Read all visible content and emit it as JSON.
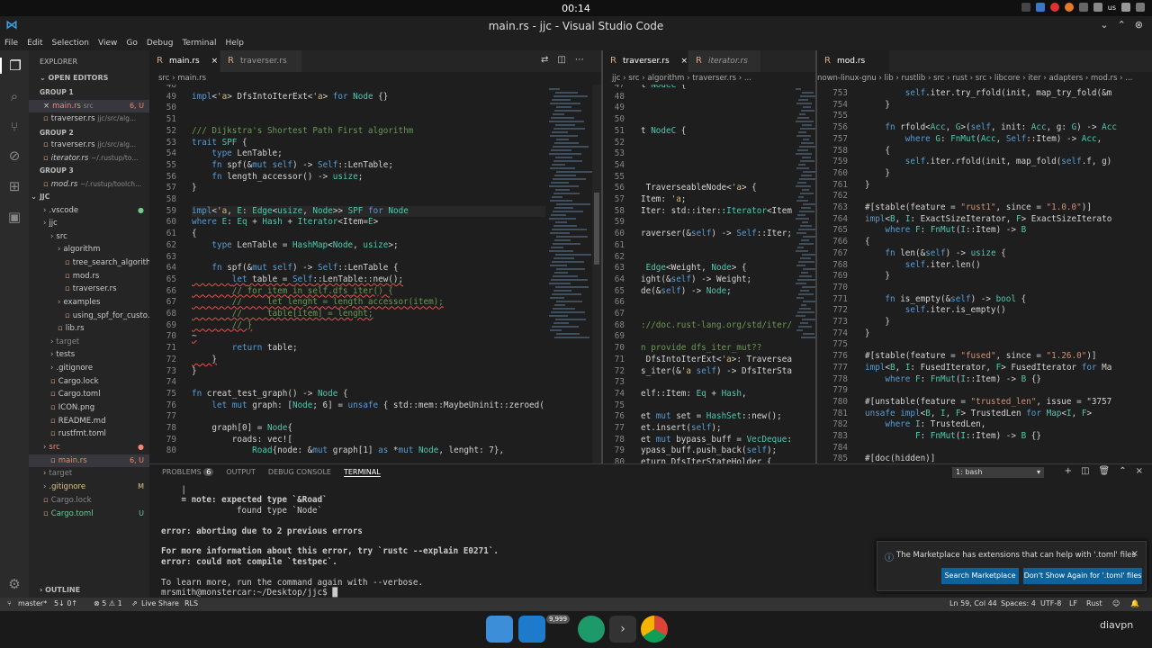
{
  "system": {
    "clock": "00:14",
    "locale": "us"
  },
  "window": {
    "title": "main.rs - jjc - Visual Studio Code"
  },
  "menu": [
    "File",
    "Edit",
    "Selection",
    "View",
    "Go",
    "Debug",
    "Terminal",
    "Help"
  ],
  "sidebar": {
    "title": "EXPLORER",
    "open_editors": "OPEN EDITORS",
    "items": [
      {
        "label": "GROUP 1",
        "cls": "hdr",
        "lvl": 0
      },
      {
        "label": "main.rs",
        "hint": "src",
        "badge": "6, U",
        "cls": "err",
        "lvl": 1,
        "x": true,
        "sel": true
      },
      {
        "label": "traverser.rs",
        "hint": "jjc/src/alg...",
        "cls": "",
        "lvl": 1
      },
      {
        "label": "GROUP 2",
        "cls": "hdr",
        "lvl": 0
      },
      {
        "label": "traverser.rs",
        "hint": "jjc/src/alg...",
        "cls": "",
        "lvl": 1
      },
      {
        "label": "iterator.rs",
        "hint": "~/.rustup/to...",
        "cls": "ital",
        "lvl": 1
      },
      {
        "label": "GROUP 3",
        "cls": "hdr",
        "lvl": 0
      },
      {
        "label": "mod.rs",
        "hint": "~/.rustup/toolch...",
        "cls": "ital",
        "lvl": 1
      },
      {
        "label": "JJC",
        "cls": "hdr",
        "lvl": -1
      },
      {
        "label": ".vscode",
        "cls": "",
        "lvl": 1,
        "dot": "untr"
      },
      {
        "label": "jjc",
        "cls": "",
        "lvl": 1
      },
      {
        "label": "src",
        "cls": "",
        "lvl": 2
      },
      {
        "label": "algorithm",
        "cls": "",
        "lvl": 3
      },
      {
        "label": "tree_search_algorith...",
        "cls": "",
        "lvl": 4
      },
      {
        "label": "mod.rs",
        "cls": "",
        "lvl": 4
      },
      {
        "label": "traverser.rs",
        "cls": "",
        "lvl": 4
      },
      {
        "label": "examples",
        "cls": "",
        "lvl": 3
      },
      {
        "label": "using_spf_for_custo...",
        "cls": "",
        "lvl": 4
      },
      {
        "label": "lib.rs",
        "cls": "",
        "lvl": 3
      },
      {
        "label": "target",
        "cls": "dim",
        "lvl": 2
      },
      {
        "label": "tests",
        "cls": "",
        "lvl": 2
      },
      {
        "label": ".gitignore",
        "cls": "",
        "lvl": 2
      },
      {
        "label": "Cargo.lock",
        "cls": "",
        "lvl": 2
      },
      {
        "label": "Cargo.toml",
        "cls": "",
        "lvl": 2
      },
      {
        "label": "ICON.png",
        "cls": "",
        "lvl": 2
      },
      {
        "label": "README.md",
        "cls": "",
        "lvl": 2
      },
      {
        "label": "rustfmt.toml",
        "cls": "",
        "lvl": 2
      },
      {
        "label": "src",
        "cls": "err",
        "lvl": 1,
        "dot": "err"
      },
      {
        "label": "main.rs",
        "badge": "6, U",
        "cls": "err",
        "lvl": 2,
        "sel": true
      },
      {
        "label": "target",
        "cls": "dim",
        "lvl": 1
      },
      {
        "label": ".gitignore",
        "badge": "M",
        "cls": "mod",
        "lvl": 1
      },
      {
        "label": "Cargo.lock",
        "cls": "dim",
        "lvl": 1
      },
      {
        "label": "Cargo.toml",
        "badge": "U",
        "cls": "untr",
        "lvl": 1
      }
    ],
    "outline": "OUTLINE"
  },
  "groups": [
    {
      "tabs": [
        {
          "label": "main.rs",
          "active": true,
          "close": "×"
        },
        {
          "label": "traverser.rs",
          "active": false
        }
      ],
      "crumb": "src  ›  main.rs"
    },
    {
      "tabs": [
        {
          "label": "traverser.rs",
          "active": true,
          "close": "×"
        },
        {
          "label": "iterator.rs",
          "active": false
        }
      ],
      "crumb": "jjc  ›  src  ›  algorithm  ›  traverser.rs  ›  ..."
    },
    {
      "tabs": [
        {
          "label": "mod.rs",
          "active": true
        }
      ],
      "crumb": "nown-linux-gnu  ›  lib  ›  rustlib  ›  src  ›  rust  ›  src  ›  libcore  ›  iter  ›  adapters  ›  mod.rs  ›  ..."
    }
  ],
  "editor1": {
    "lines": [
      {
        "n": "48",
        "t": ""
      },
      {
        "n": "49",
        "t": "impl<'a> DfsIntoIterExt<'a> for Node {}"
      },
      {
        "n": "50",
        "t": ""
      },
      {
        "n": "51",
        "t": ""
      },
      {
        "n": "52",
        "t": "/// Dijkstra's Shortest Path First algorithm",
        "c": "cm"
      },
      {
        "n": "53",
        "t": "trait SPF {"
      },
      {
        "n": "54",
        "t": "    type LenTable;"
      },
      {
        "n": "55",
        "t": "    fn spf(&mut self) -> Self::LenTable;"
      },
      {
        "n": "56",
        "t": "    fn length_accessor() -> usize;"
      },
      {
        "n": "57",
        "t": "}"
      },
      {
        "n": "58",
        "t": ""
      },
      {
        "n": "59",
        "t": "impl<'a, E: Edge<usize, Node>> SPF for Node"
      },
      {
        "n": "60",
        "t": "where E: Eq + Hash + Iterator<Item=E>"
      },
      {
        "n": "61",
        "t": "{"
      },
      {
        "n": "62",
        "t": "    type LenTable = HashMap<Node, usize>;"
      },
      {
        "n": "63",
        "t": ""
      },
      {
        "n": "64",
        "t": "    fn spf(&mut self) -> Self::LenTable {"
      },
      {
        "n": "65",
        "t": "        let table = Self::LenTable::new();",
        "s": true
      },
      {
        "n": "66",
        "t": "        // for item in self.dfs_iter() {",
        "c": "cm",
        "s": true
      },
      {
        "n": "67",
        "t": "        //     let lenght = length_accessor(item);",
        "c": "cm",
        "s": true
      },
      {
        "n": "68",
        "t": "        //     table[item] = lenght;",
        "c": "cm",
        "s": true
      },
      {
        "n": "69",
        "t": "        // }",
        "c": "cm",
        "s": true
      },
      {
        "n": "70",
        "t": "~",
        "s": true
      },
      {
        "n": "71",
        "t": "        return table;"
      },
      {
        "n": "72",
        "t": "    }",
        "s": true
      },
      {
        "n": "73",
        "t": "}"
      },
      {
        "n": "74",
        "t": ""
      },
      {
        "n": "75",
        "t": "fn creat_test_graph() -> Node {"
      },
      {
        "n": "76",
        "t": "    let mut graph: [Node; 6] = unsafe { std::mem::MaybeUninit::zeroed()"
      },
      {
        "n": "77",
        "t": ""
      },
      {
        "n": "78",
        "t": "    graph[0] = Node{"
      },
      {
        "n": "79",
        "t": "        roads: vec!["
      },
      {
        "n": "80",
        "t": "            Road{node: &mut graph[1] as *mut Node, lenght: 7},"
      }
    ]
  },
  "editor2": {
    "lines": [
      {
        "n": "47",
        "t": "t NodeC {"
      },
      {
        "n": "48",
        "t": ""
      },
      {
        "n": "49",
        "t": ""
      },
      {
        "n": "50",
        "t": ""
      },
      {
        "n": "51",
        "t": "t NodeC {"
      },
      {
        "n": "52",
        "t": ""
      },
      {
        "n": "53",
        "t": ""
      },
      {
        "n": "54",
        "t": ""
      },
      {
        "n": "55",
        "t": ""
      },
      {
        "n": "56",
        "t": " TraverseableNode<'a> {"
      },
      {
        "n": "57",
        "t": "Item: 'a;"
      },
      {
        "n": "58",
        "t": "Iter: std::iter::Iterator<Item"
      },
      {
        "n": "59",
        "t": ""
      },
      {
        "n": "60",
        "t": "raverser(&self) -> Self::Iter;"
      },
      {
        "n": "61",
        "t": ""
      },
      {
        "n": "62",
        "t": ""
      },
      {
        "n": "63",
        "t": " Edge<Weight, Node> {"
      },
      {
        "n": "64",
        "t": "ight(&self) -> Weight;"
      },
      {
        "n": "65",
        "t": "de(&self) -> Node;"
      },
      {
        "n": "66",
        "t": ""
      },
      {
        "n": "67",
        "t": ""
      },
      {
        "n": "68",
        "t": "://doc.rust-lang.org/std/iter/",
        "c": "cm"
      },
      {
        "n": "69",
        "t": ""
      },
      {
        "n": "70",
        "t": "n provide dfs_iter_mut??",
        "c": "cm"
      },
      {
        "n": "71",
        "t": " DfsIntoIterExt<'a>: Traversea"
      },
      {
        "n": "72",
        "t": "s_iter(&'a self) -> DfsIterSta"
      },
      {
        "n": "73",
        "t": ""
      },
      {
        "n": "74",
        "t": "elf::Item: Eq + Hash,"
      },
      {
        "n": "75",
        "t": ""
      },
      {
        "n": "76",
        "t": "et mut set = HashSet::new();"
      },
      {
        "n": "77",
        "t": "et.insert(self);"
      },
      {
        "n": "78",
        "t": "et mut bypass_buff = VecDeque:"
      },
      {
        "n": "79",
        "t": "ypass_buff.push_back(self);"
      },
      {
        "n": "80",
        "t": "eturn DfsIterStateHolder {"
      }
    ]
  },
  "editor3": {
    "lines": [
      {
        "n": "753",
        "t": "        self.iter.try_rfold(init, map_try_fold(&m"
      },
      {
        "n": "754",
        "t": "    }"
      },
      {
        "n": "755",
        "t": ""
      },
      {
        "n": "756",
        "t": "    fn rfold<Acc, G>(self, init: Acc, g: G) -> Acc"
      },
      {
        "n": "757",
        "t": "        where G: FnMut(Acc, Self::Item) -> Acc,"
      },
      {
        "n": "758",
        "t": "    {"
      },
      {
        "n": "759",
        "t": "        self.iter.rfold(init, map_fold(self.f, g)"
      },
      {
        "n": "760",
        "t": "    }"
      },
      {
        "n": "761",
        "t": "}"
      },
      {
        "n": "762",
        "t": ""
      },
      {
        "n": "763",
        "t": "#[stable(feature = \"rust1\", since = \"1.0.0\")]"
      },
      {
        "n": "764",
        "t": "impl<B, I: ExactSizeIterator, F> ExactSizeIterato"
      },
      {
        "n": "765",
        "t": "    where F: FnMut(I::Item) -> B"
      },
      {
        "n": "766",
        "t": "{"
      },
      {
        "n": "767",
        "t": "    fn len(&self) -> usize {"
      },
      {
        "n": "768",
        "t": "        self.iter.len()"
      },
      {
        "n": "769",
        "t": "    }"
      },
      {
        "n": "770",
        "t": ""
      },
      {
        "n": "771",
        "t": "    fn is_empty(&self) -> bool {"
      },
      {
        "n": "772",
        "t": "        self.iter.is_empty()"
      },
      {
        "n": "773",
        "t": "    }"
      },
      {
        "n": "774",
        "t": "}"
      },
      {
        "n": "775",
        "t": ""
      },
      {
        "n": "776",
        "t": "#[stable(feature = \"fused\", since = \"1.26.0\")]"
      },
      {
        "n": "777",
        "t": "impl<B, I: FusedIterator, F> FusedIterator for Ma"
      },
      {
        "n": "778",
        "t": "    where F: FnMut(I::Item) -> B {}"
      },
      {
        "n": "779",
        "t": ""
      },
      {
        "n": "780",
        "t": "#[unstable(feature = \"trusted_len\", issue = \"3757"
      },
      {
        "n": "781",
        "t": "unsafe impl<B, I, F> TrustedLen for Map<I, F>"
      },
      {
        "n": "782",
        "t": "    where I: TrustedLen,"
      },
      {
        "n": "783",
        "t": "          F: FnMut(I::Item) -> B {}"
      },
      {
        "n": "784",
        "t": ""
      },
      {
        "n": "785",
        "t": "#[doc(hidden)]"
      }
    ]
  },
  "panel": {
    "tabs": [
      {
        "label": "PROBLEMS",
        "badge": "6"
      },
      {
        "label": "OUTPUT"
      },
      {
        "label": "DEBUG CONSOLE"
      },
      {
        "label": "TERMINAL",
        "active": true
      }
    ],
    "shell": "1: bash",
    "terminal": [
      {
        "t": "    |",
        "c": "mc"
      },
      {
        "t": "    = note: expected type `&Road`"
      },
      {
        "t": "               found type `Node`"
      },
      {
        "t": ""
      },
      {
        "t": "error: aborting due to 2 previous errors",
        "c": "err"
      },
      {
        "t": ""
      },
      {
        "t": "For more information about this error, try `rustc --explain E0271`."
      },
      {
        "t": "error: could not compile `testpec`.",
        "c": "err"
      },
      {
        "t": ""
      },
      {
        "t": "To learn more, run the command again with --verbose."
      },
      {
        "t": "mrsmith@monstercar:~/Desktop/jjc$ ",
        "c": "untr"
      }
    ]
  },
  "notification": {
    "message": "The Marketplace has extensions that can help with '.toml' files",
    "btn_search": "Search Marketplace",
    "btn_dont": "Don't Show Again for '.toml' files"
  },
  "status": {
    "branch": "master*",
    "sync": "5↓ 0↑",
    "problems": "⊗ 5 ⚠ 1",
    "liveshare": "Live Share",
    "rls": "RLS",
    "position": "Ln 59, Col 44",
    "spaces": "Spaces: 4",
    "encoding": "UTF-8",
    "eol": "LF",
    "language": "Rust"
  },
  "dock": {
    "badge": "9,999",
    "label": "diavpn"
  }
}
